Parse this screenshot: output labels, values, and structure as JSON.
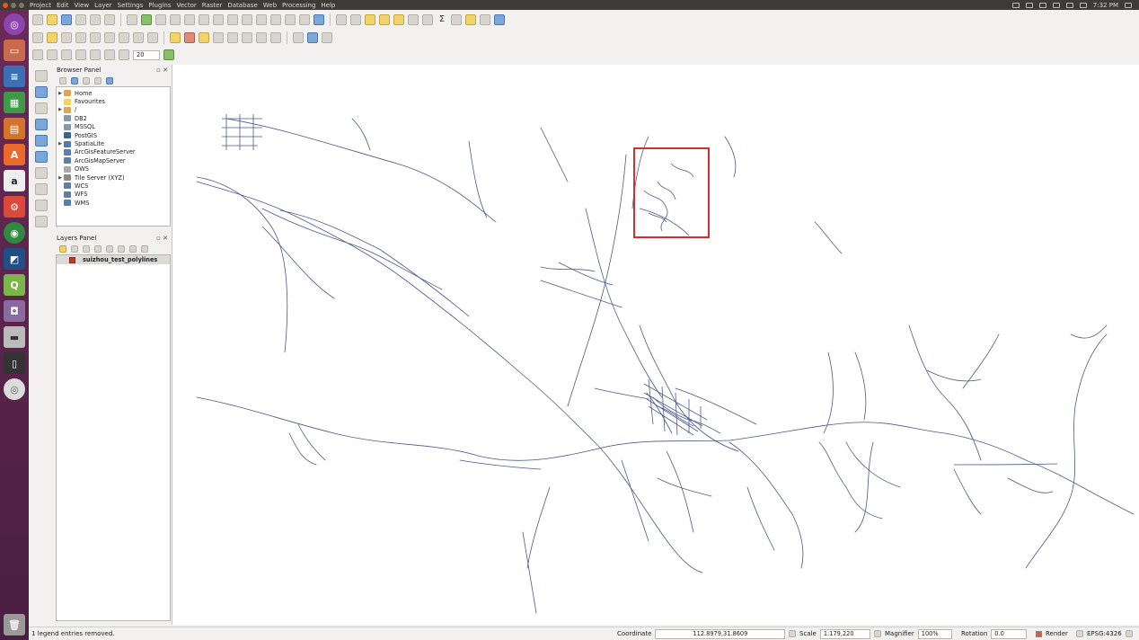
{
  "menu": [
    "Project",
    "Edit",
    "View",
    "Layer",
    "Settings",
    "Plugins",
    "Vector",
    "Raster",
    "Database",
    "Web",
    "Processing",
    "Help"
  ],
  "tray": {
    "time": "7:32 PM"
  },
  "browser_panel": {
    "title": "Browser Panel",
    "items": [
      {
        "label": "Home",
        "expandable": true,
        "icon": "folder-icon",
        "color": "#e0a552"
      },
      {
        "label": "Favourites",
        "expandable": false,
        "icon": "star-icon",
        "color": "#f3d35a"
      },
      {
        "label": "/",
        "expandable": true,
        "icon": "folder-icon",
        "color": "#e0a552"
      },
      {
        "label": "DB2",
        "expandable": false,
        "icon": "database-icon",
        "color": "#8899aa"
      },
      {
        "label": "MSSQL",
        "expandable": false,
        "icon": "database-icon",
        "color": "#8899aa"
      },
      {
        "label": "PostGIS",
        "expandable": false,
        "icon": "elephant-icon",
        "color": "#336791"
      },
      {
        "label": "SpatiaLite",
        "expandable": true,
        "icon": "feather-icon",
        "color": "#4a7fb5"
      },
      {
        "label": "ArcGisFeatureServer",
        "expandable": false,
        "icon": "globe-icon",
        "color": "#5b7fa8"
      },
      {
        "label": "ArcGisMapServer",
        "expandable": false,
        "icon": "globe-icon",
        "color": "#5b7fa8"
      },
      {
        "label": "OWS",
        "expandable": false,
        "icon": "ows-icon",
        "color": "#aaaaaa"
      },
      {
        "label": "Tile Server (XYZ)",
        "expandable": true,
        "icon": "tile-icon",
        "color": "#8a8a8a"
      },
      {
        "label": "WCS",
        "expandable": false,
        "icon": "globe-icon",
        "color": "#5b7fa8"
      },
      {
        "label": "WFS",
        "expandable": false,
        "icon": "globe-icon",
        "color": "#5b7fa8"
      },
      {
        "label": "WMS",
        "expandable": false,
        "icon": "globe-icon",
        "color": "#5b7fa8"
      }
    ]
  },
  "layers_panel": {
    "title": "Layers Panel",
    "layers": [
      {
        "name": "suizhou_test_polylines",
        "checked": true
      }
    ]
  },
  "status": {
    "message": "1 legend entries removed.",
    "coordinate_label": "Coordinate",
    "coordinate_value": "112.8979,31.8609",
    "scale_label": "Scale",
    "scale_value": "1:179,220",
    "magnifier_label": "Magnifier",
    "magnifier_value": "100%",
    "rotation_label": "Rotation",
    "rotation_value": "0.0",
    "render_label": "Render",
    "crs": "EPSG:4326"
  },
  "toolbar3": {
    "tolerance_value": "20"
  },
  "colors": {
    "road": "#4a5a8a",
    "highlight": "#d32f2f",
    "launcher": "#5e2750"
  }
}
